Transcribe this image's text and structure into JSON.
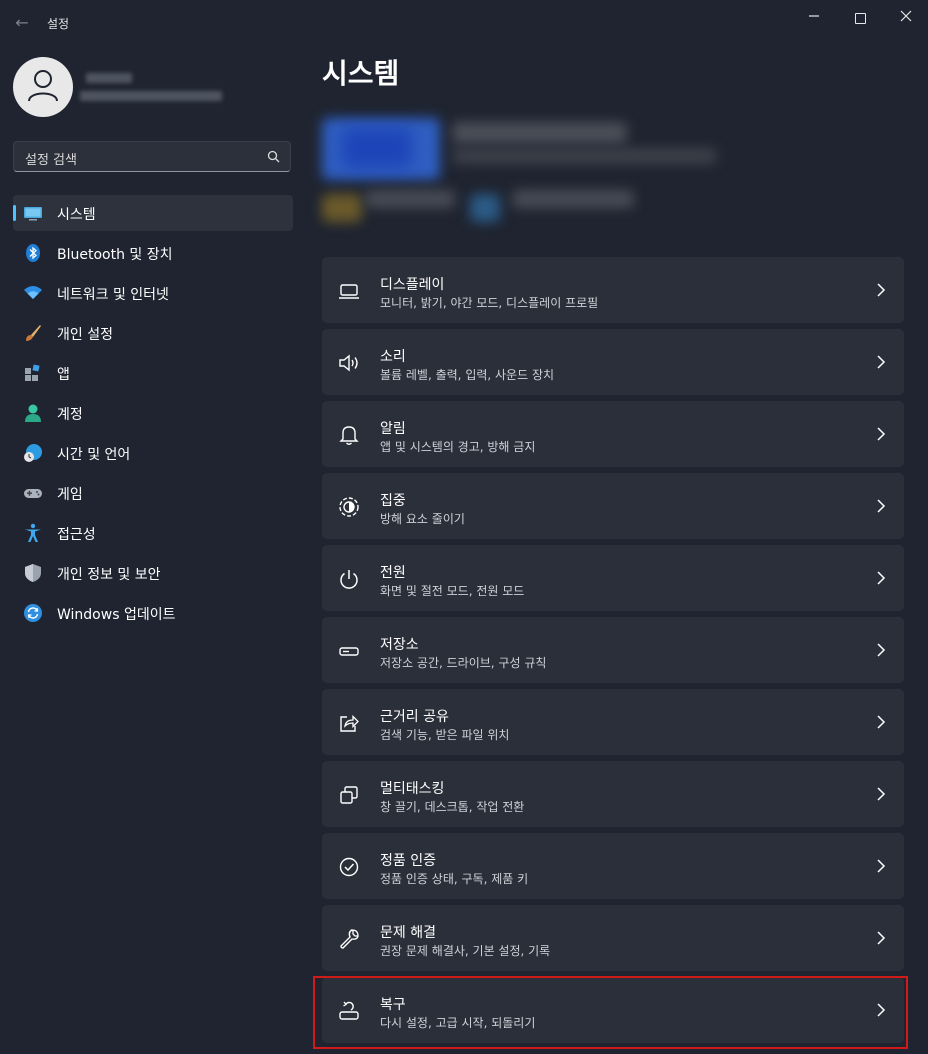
{
  "window": {
    "title": "설정"
  },
  "search": {
    "placeholder": "설정 검색"
  },
  "sidebar": {
    "items": [
      {
        "label": "시스템",
        "icon": "system-display-icon"
      },
      {
        "label": "Bluetooth 및 장치",
        "icon": "bluetooth-icon"
      },
      {
        "label": "네트워크 및 인터넷",
        "icon": "wifi-icon"
      },
      {
        "label": "개인 설정",
        "icon": "paintbrush-icon"
      },
      {
        "label": "앱",
        "icon": "apps-icon"
      },
      {
        "label": "계정",
        "icon": "account-icon"
      },
      {
        "label": "시간 및 언어",
        "icon": "globe-clock-icon"
      },
      {
        "label": "게임",
        "icon": "gamepad-icon"
      },
      {
        "label": "접근성",
        "icon": "accessibility-icon"
      },
      {
        "label": "개인 정보 및 보안",
        "icon": "shield-icon"
      },
      {
        "label": "Windows 업데이트",
        "icon": "update-icon"
      }
    ]
  },
  "main": {
    "title": "시스템",
    "cards": [
      {
        "title": "디스플레이",
        "subtitle": "모니터, 밝기, 야간 모드, 디스플레이 프로필",
        "icon": "display-icon"
      },
      {
        "title": "소리",
        "subtitle": "볼륨 레벨, 출력, 입력, 사운드 장치",
        "icon": "speaker-icon"
      },
      {
        "title": "알림",
        "subtitle": "앱 및 시스템의 경고, 방해 금지",
        "icon": "bell-icon"
      },
      {
        "title": "집중",
        "subtitle": "방해 요소 줄이기",
        "icon": "focus-icon"
      },
      {
        "title": "전원",
        "subtitle": "화면 및 절전 모드, 전원 모드",
        "icon": "power-icon"
      },
      {
        "title": "저장소",
        "subtitle": "저장소 공간, 드라이브, 구성 규칙",
        "icon": "storage-icon"
      },
      {
        "title": "근거리 공유",
        "subtitle": "검색 기능, 받은 파일 위치",
        "icon": "share-icon"
      },
      {
        "title": "멀티태스킹",
        "subtitle": "창 끌기, 데스크톱, 작업 전환",
        "icon": "multitasking-icon"
      },
      {
        "title": "정품 인증",
        "subtitle": "정품 인증 상태, 구독, 제품 키",
        "icon": "activation-check-icon"
      },
      {
        "title": "문제 해결",
        "subtitle": "권장 문제 해결사, 기본 설정, 기록",
        "icon": "wrench-icon"
      },
      {
        "title": "복구",
        "subtitle": "다시 설정, 고급 시작, 되돌리기",
        "icon": "recovery-icon"
      }
    ]
  },
  "colors": {
    "background": "#1f2430",
    "card": "#2b2f39",
    "accent": "#4cc2ff",
    "highlight": "#d11a1a"
  }
}
